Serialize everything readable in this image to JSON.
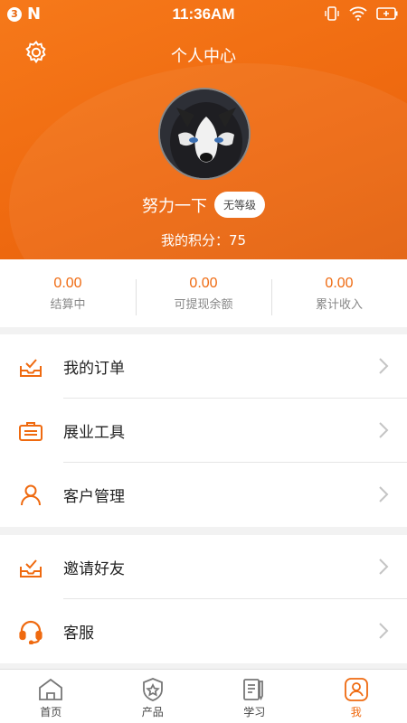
{
  "status_bar": {
    "notification_count": "3",
    "time": "11:36AM"
  },
  "header": {
    "title": "个人中心",
    "user_name": "努力一下",
    "level_badge": "无等级",
    "points_text": "我的积分：75"
  },
  "stats": [
    {
      "value": "0.00",
      "label": "结算中"
    },
    {
      "value": "0.00",
      "label": "可提现余额"
    },
    {
      "value": "0.00",
      "label": "累计收入"
    }
  ],
  "menu_group_1": [
    {
      "label": "我的订单",
      "icon": "order-tray-icon"
    },
    {
      "label": "展业工具",
      "icon": "briefcase-icon"
    },
    {
      "label": "客户管理",
      "icon": "person-icon"
    }
  ],
  "menu_group_2": [
    {
      "label": "邀请好友",
      "icon": "invite-tray-icon"
    },
    {
      "label": "客服",
      "icon": "headset-icon"
    }
  ],
  "bottom_nav": [
    {
      "label": "首页",
      "icon": "home-icon"
    },
    {
      "label": "产品",
      "icon": "shield-star-icon"
    },
    {
      "label": "学习",
      "icon": "notebook-pen-icon"
    },
    {
      "label": "我",
      "icon": "profile-icon",
      "active": true
    }
  ],
  "colors": {
    "accent": "#ef6a10",
    "text": "#222222",
    "muted": "#888888"
  }
}
